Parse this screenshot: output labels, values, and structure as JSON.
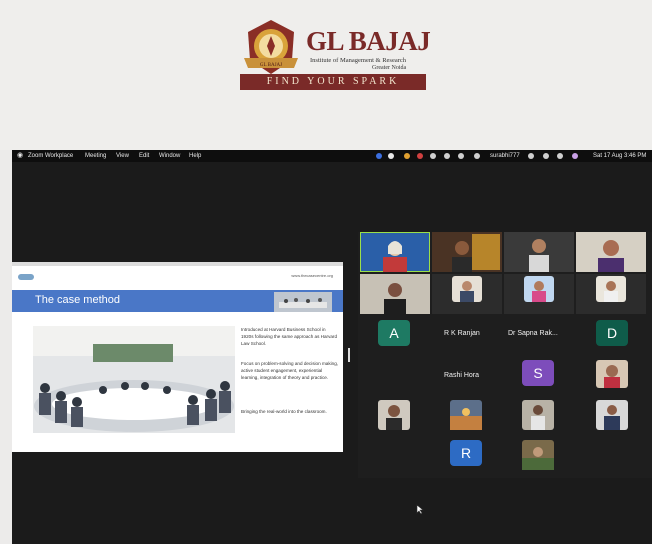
{
  "logo": {
    "title": "GL BAJAJ",
    "subtitle_line1": "Institute of Management & Research",
    "subtitle_line2": "Greater Noida",
    "emblem_text": "GL BAJAJ",
    "tagline": "FIND YOUR SPARK"
  },
  "menubar": {
    "apple_icon": "apple-icon",
    "items": [
      "Zoom Workplace",
      "Meeting",
      "View",
      "Edit",
      "Window",
      "Help"
    ],
    "user": "surabhi777",
    "datetime": "Sat 17 Aug 3:46 PM"
  },
  "slide": {
    "heading": "The case method",
    "url": "www.thecasecentre.org",
    "paragraph1": "Introduced at Harvard Business School in 1920s following the same approach as Harvard Law School.",
    "paragraph2": "Focus on problem-solving and decision making, active student engagement, experiential learning, integration of theory and practice.",
    "paragraph3": "Bringing the real-world into the classroom."
  },
  "participants": {
    "avatar_a": "A",
    "avatar_d": "D",
    "avatar_s": "S",
    "avatar_r": "R",
    "name_rk": "R K Ranjan",
    "name_sapna": "Dr Sapna Rak...",
    "name_rashi": "Rashi Hora"
  },
  "colors": {
    "teal_avatar": "#1e7a63",
    "dark_teal_avatar": "#0f5c4a",
    "purple_avatar": "#7d4dbb",
    "blue_avatar": "#2d6bc4",
    "brand": "#7a2a28",
    "slide_band": "#4a77c7"
  }
}
